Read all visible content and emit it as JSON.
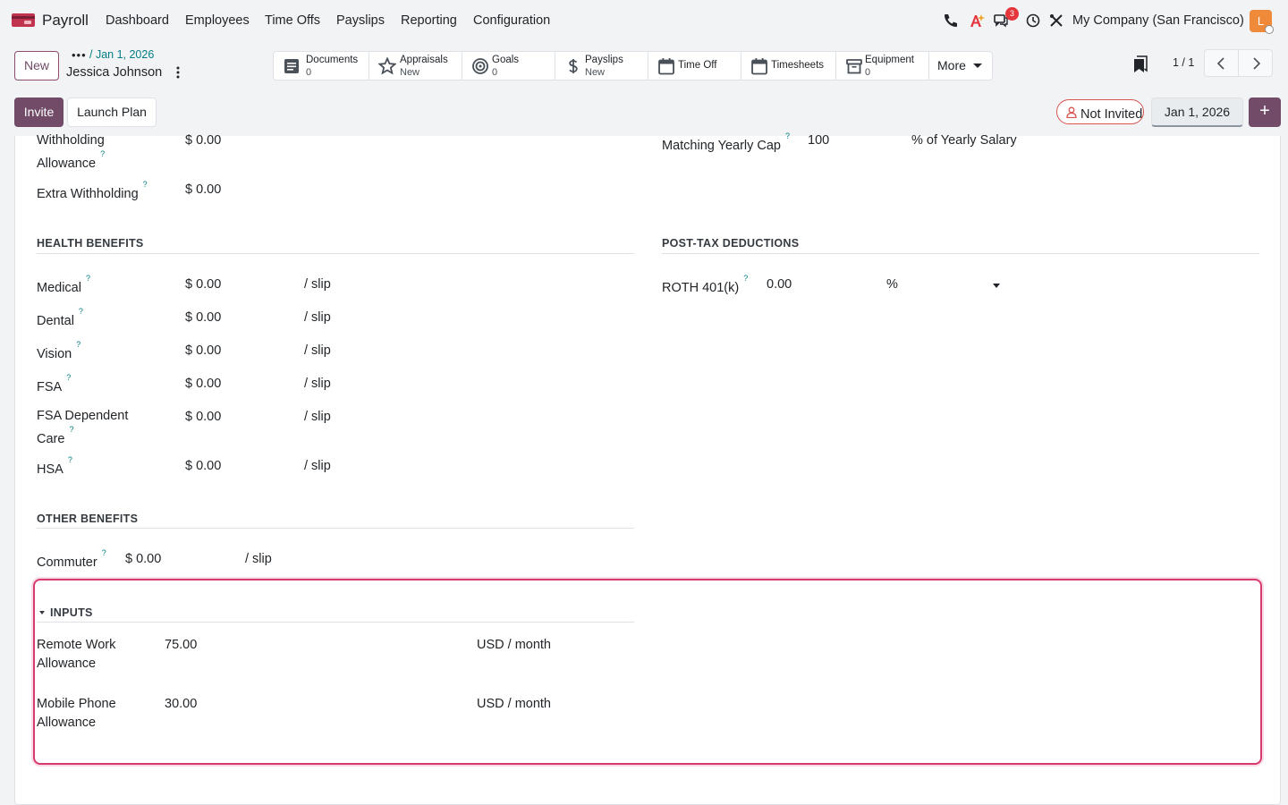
{
  "topnav": {
    "app_name": "Payroll",
    "menus": [
      "Dashboard",
      "Employees",
      "Time Offs",
      "Payslips",
      "Reporting",
      "Configuration"
    ],
    "chat_badge": "3",
    "company": "My Company (San Francisco)",
    "avatar_letter": "L"
  },
  "control": {
    "new_label": "New",
    "breadcrumb_link": "/ Jan 1, 2026",
    "record_name": "Jessica Johnson",
    "smart_buttons": {
      "documents": {
        "label": "Documents",
        "value": "0"
      },
      "appraisals": {
        "label": "Appraisals",
        "value": "New"
      },
      "goals": {
        "label": "Goals",
        "value": "0"
      },
      "payslips": {
        "label": "Payslips",
        "value": "New"
      },
      "timeoff": {
        "label": "Time Off"
      },
      "timesheets": {
        "label": "Timesheets"
      },
      "equipment": {
        "label": "Equipment",
        "value": "0"
      },
      "more": {
        "label": "More"
      }
    },
    "pager": "1 / 1",
    "invite_label": "Invite",
    "launch_plan_label": "Launch Plan",
    "status": "Not Invited",
    "date": "Jan 1, 2026",
    "plus": "+"
  },
  "form": {
    "withholding_allowance": {
      "label_1": "Withholding",
      "label_2": "Allowance",
      "value": "$ 0.00"
    },
    "extra_withholding": {
      "label": "Extra Withholding",
      "value": "$ 0.00"
    },
    "matching_cap": {
      "label": "Matching Yearly Cap",
      "value": "100",
      "unit": "% of Yearly Salary"
    },
    "health_title": "HEALTH BENEFITS",
    "health": [
      {
        "label": "Medical",
        "value": "$ 0.00",
        "unit": "/ slip"
      },
      {
        "label": "Dental",
        "value": "$ 0.00",
        "unit": "/ slip"
      },
      {
        "label": "Vision",
        "value": "$ 0.00",
        "unit": "/ slip"
      },
      {
        "label": "FSA",
        "value": "$ 0.00",
        "unit": "/ slip"
      },
      {
        "label_1": "FSA Dependent",
        "label_2": "Care",
        "value": "$ 0.00",
        "unit": "/ slip"
      },
      {
        "label": "HSA",
        "value": "$ 0.00",
        "unit": "/ slip"
      }
    ],
    "post_tax_title": "POST-TAX DEDUCTIONS",
    "roth": {
      "label": "ROTH 401(k)",
      "value": "0.00",
      "unit": "%"
    },
    "other_title": "OTHER BENEFITS",
    "commuter": {
      "label": "Commuter",
      "value": "$ 0.00",
      "unit": "/ slip"
    },
    "inputs_title": "INPUTS",
    "inputs": [
      {
        "label_1": "Remote Work",
        "label_2": "Allowance",
        "value": "75.00",
        "unit": "USD / month"
      },
      {
        "label_1": "Mobile Phone",
        "label_2": "Allowance",
        "value": "30.00",
        "unit": "USD / month"
      }
    ],
    "help_mark": "?"
  },
  "colors": {
    "brand": "#714b67",
    "link": "#017e84",
    "highlight": "#d63a6f",
    "danger": "#d9534f"
  }
}
